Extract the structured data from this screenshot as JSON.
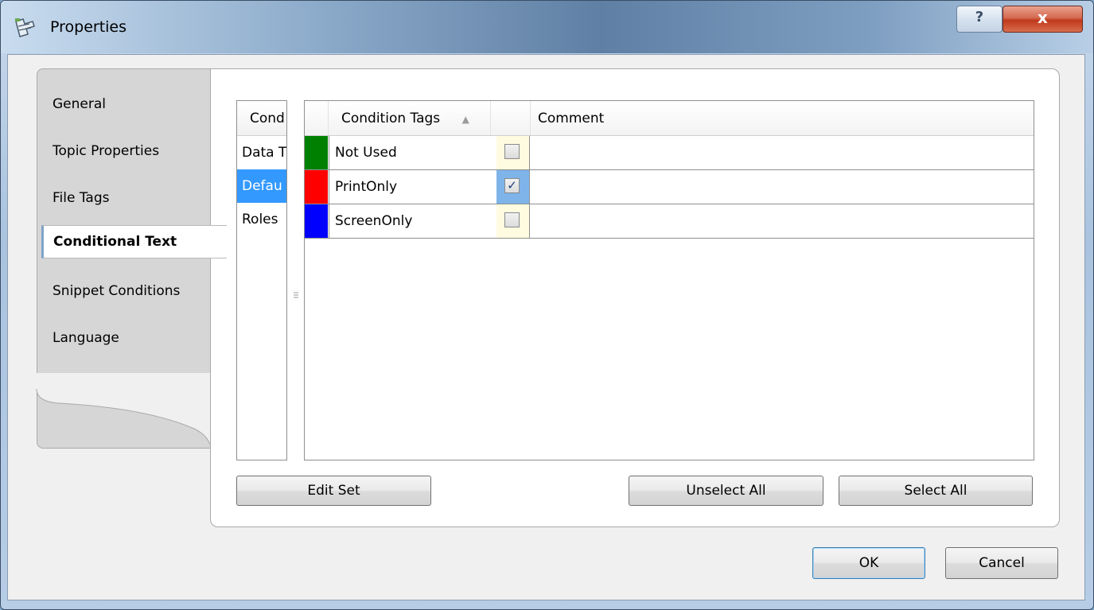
{
  "window": {
    "title": "Properties",
    "help_label": "?",
    "close_label": "x"
  },
  "tabs": [
    {
      "label": "General"
    },
    {
      "label": "Topic Properties"
    },
    {
      "label": "File Tags"
    },
    {
      "label": "Conditional Text"
    },
    {
      "label": "Snippet Conditions"
    },
    {
      "label": "Language"
    }
  ],
  "active_tab": "Conditional Text",
  "sets_list": {
    "header": "Cond",
    "items": [
      "Data T",
      "Defau",
      "Roles"
    ],
    "selected_index": 1
  },
  "grid": {
    "columns": [
      "Condition Tags",
      "Comment"
    ],
    "sort_indicator": "▲",
    "rows": [
      {
        "color": "#008000",
        "tag": "Not Used",
        "checked": false,
        "comment": ""
      },
      {
        "color": "#ff0000",
        "tag": "PrintOnly",
        "checked": true,
        "comment": ""
      },
      {
        "color": "#0000ff",
        "tag": "ScreenOnly",
        "checked": false,
        "comment": ""
      }
    ]
  },
  "buttons": {
    "edit_set": "Edit Set",
    "unselect_all": "Unselect All",
    "select_all": "Select All",
    "ok": "OK",
    "cancel": "Cancel"
  },
  "check_glyph": "✓"
}
